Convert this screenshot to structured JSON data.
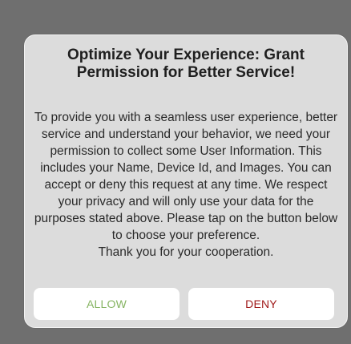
{
  "dialog": {
    "title": "Optimize Your Experience: Grant Permission for Better Service!",
    "message": "To provide you with a seamless user experience, better service and understand your behavior, we need your permission to collect some User Information. This includes your Name, Device Id, and Images. You can accept or deny this request at any time. We respect your privacy and will only use your data for the purposes stated above. Please tap on the button below to choose your preference.",
    "closing": "Thank you for your cooperation.",
    "allow_label": "ALLOW",
    "deny_label": "DENY"
  },
  "colors": {
    "allow": "#86b462",
    "deny": "#a01a1a",
    "dialog_background": "#dcdcdc",
    "overlay": "#6f6f6f"
  }
}
